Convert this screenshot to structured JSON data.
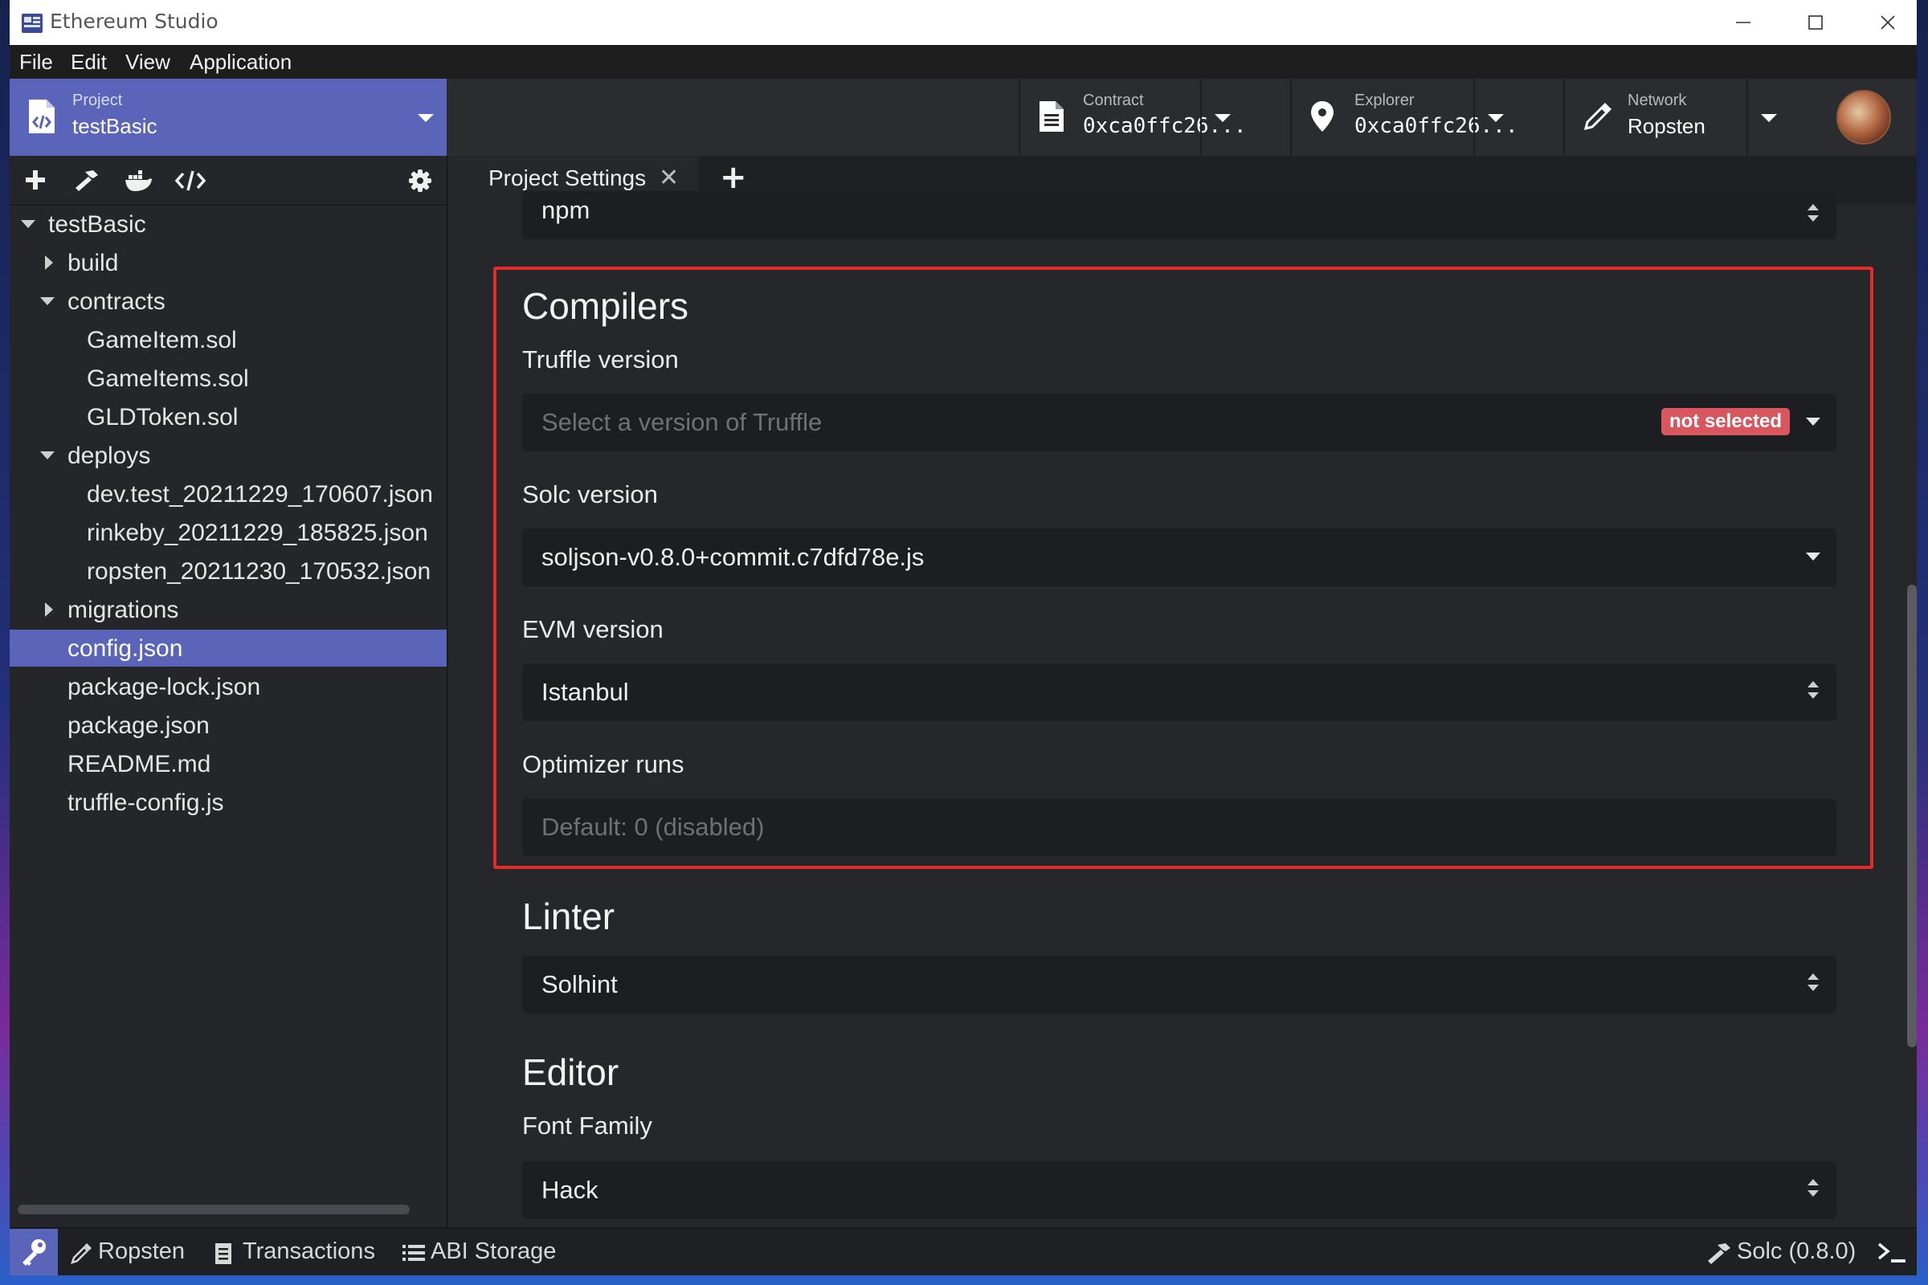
{
  "window": {
    "title": "Ethereum Studio"
  },
  "menu": [
    "File",
    "Edit",
    "View",
    "Application"
  ],
  "header": {
    "project": {
      "caption": "Project",
      "name": "testBasic"
    },
    "contract": {
      "caption": "Contract",
      "value": "0xca0ffc26..."
    },
    "explorer": {
      "caption": "Explorer",
      "value": "0xca0ffc26..."
    },
    "network": {
      "caption": "Network",
      "value": "Ropsten"
    }
  },
  "sidebar": {
    "tree": [
      {
        "label": "testBasic",
        "level": 0,
        "state": "expanded"
      },
      {
        "label": "build",
        "level": 1,
        "state": "collapsed"
      },
      {
        "label": "contracts",
        "level": 1,
        "state": "expanded"
      },
      {
        "label": "GameItem.sol",
        "level": 2,
        "state": "file"
      },
      {
        "label": "GameItems.sol",
        "level": 2,
        "state": "file"
      },
      {
        "label": "GLDToken.sol",
        "level": 2,
        "state": "file"
      },
      {
        "label": "deploys",
        "level": 1,
        "state": "expanded"
      },
      {
        "label": "dev.test_20211229_170607.json",
        "level": 2,
        "state": "file"
      },
      {
        "label": "rinkeby_20211229_185825.json",
        "level": 2,
        "state": "file"
      },
      {
        "label": "ropsten_20211230_170532.json",
        "level": 2,
        "state": "file"
      },
      {
        "label": "migrations",
        "level": 1,
        "state": "collapsed"
      },
      {
        "label": "config.json",
        "level": 1,
        "state": "file",
        "selected": true
      },
      {
        "label": "package-lock.json",
        "level": 1,
        "state": "file"
      },
      {
        "label": "package.json",
        "level": 1,
        "state": "file"
      },
      {
        "label": "README.md",
        "level": 1,
        "state": "file"
      },
      {
        "label": "truffle-config.js",
        "level": 1,
        "state": "file"
      }
    ]
  },
  "tabs": [
    {
      "label": "Project Settings",
      "close": "✕"
    }
  ],
  "tab_add": "+",
  "settings": {
    "package_manager": {
      "value": "npm"
    },
    "compilers": {
      "title": "Compilers",
      "truffle": {
        "label": "Truffle version",
        "placeholder": "Select a version of Truffle",
        "badge": "not selected"
      },
      "solc": {
        "label": "Solc version",
        "value": "soljson-v0.8.0+commit.c7dfd78e.js"
      },
      "evm": {
        "label": "EVM version",
        "value": "Istanbul"
      },
      "optimizer": {
        "label": "Optimizer runs",
        "placeholder": "Default: 0 (disabled)"
      }
    },
    "linter": {
      "title": "Linter",
      "value": "Solhint"
    },
    "editor": {
      "title": "Editor",
      "font_label": "Font Family",
      "font_value": "Hack"
    }
  },
  "statusbar": {
    "network": "Ropsten",
    "transactions": "Transactions",
    "abi_storage": "ABI Storage",
    "compiler": "Solc (0.8.0)"
  },
  "colors": {
    "accent": "#5a64b8",
    "highlight": "#e52a2a",
    "badge": "#d8575f"
  }
}
